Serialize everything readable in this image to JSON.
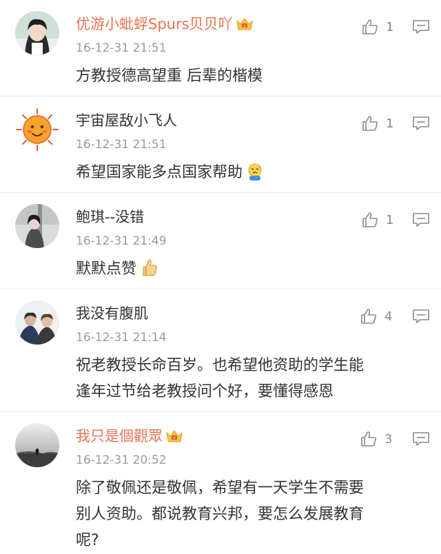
{
  "comments": [
    {
      "name": "优游小蚍蜉Spurs贝贝吖",
      "time": "16-12-31 21:51",
      "text": "方教授德高望重 后辈的楷模",
      "likes": "1",
      "vip": true
    },
    {
      "name": "宇宙屋敌小飞人",
      "time": "16-12-31 21:51",
      "text": "希望国家能多点国家帮助",
      "likes": "1",
      "vip": false
    },
    {
      "name": "鲍琪--没错",
      "time": "16-12-31 21:49",
      "text": "默默点赞",
      "likes": "1",
      "vip": false
    },
    {
      "name": "我没有腹肌",
      "time": "16-12-31 21:14",
      "text_line1": "祝老教授长命百岁。也希望他资助的学生能",
      "text_line2": "逢年过节给老教授问个好，要懂得感恩",
      "likes": "4",
      "vip": false
    },
    {
      "name": "我只是個觀眾",
      "time": "16-12-31 20:52",
      "text_line1": "除了敬佩还是敬佩，希望有一天学生不需要",
      "text_line2": "别人资助。都说教育兴邦，要怎么发展教育",
      "text_line3": "呢?",
      "likes": "3",
      "vip": true
    }
  ],
  "colors": {
    "vip_name": "#eb7350",
    "plain_name": "#333333",
    "meta": "#9a9a9a",
    "divider": "#e8e8e8"
  },
  "icons": [
    "thumbs-up-icon",
    "comment-icon",
    "vip-crown-icon",
    "sweat-emoji-icon",
    "thumbs-up-emoji-icon"
  ]
}
